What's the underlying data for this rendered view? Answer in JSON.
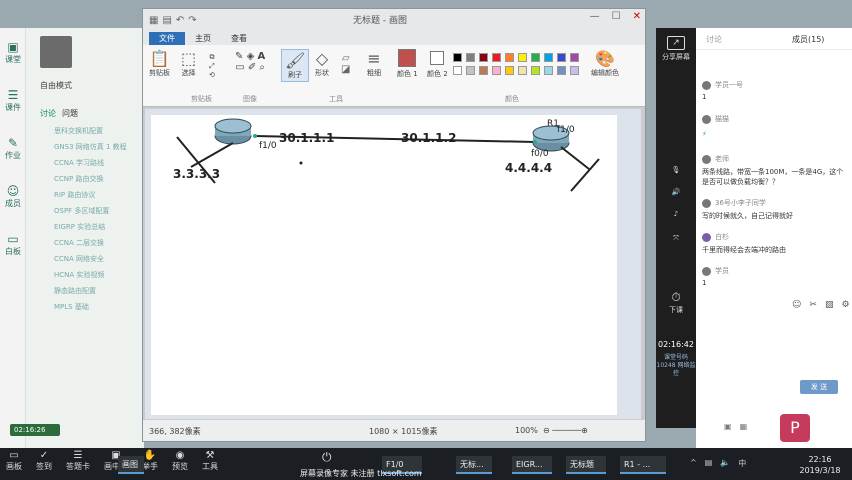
{
  "left_panel": {
    "rail": [
      {
        "icon": "classroom-icon",
        "label": "课堂"
      },
      {
        "icon": "courseware-icon",
        "label": "课件"
      },
      {
        "icon": "homework-icon",
        "label": "作业"
      },
      {
        "icon": "member-icon",
        "label": "成员"
      },
      {
        "icon": "screen-icon",
        "label": "白板"
      }
    ],
    "profile_name": "自由模式",
    "tabs": [
      "讨论",
      "问题"
    ],
    "messages": [
      "思科交换机配置",
      "GNS3 网络仿真 1 教程",
      "CCNA 学习路线",
      "CCNP 路由交换",
      "RIP 路由协议",
      "OSPF 多区域配置",
      "EIGRP 实验总结",
      "CCNA 二层交换",
      "CCNA 网络安全",
      "HCNA 实验视频",
      "静态路由配置",
      "MPLS 基础"
    ],
    "clock": "02:16:26"
  },
  "paint": {
    "title": "无标题 - 画图",
    "tabs": {
      "file": "文件",
      "home": "主页",
      "view": "查看"
    },
    "groups": {
      "clipboard": "剪贴板",
      "image": "图像",
      "tools": "工具",
      "shapes": "形状",
      "colors": "颜色"
    },
    "buttons": {
      "paste": "剪贴板",
      "select": "选择",
      "brush": "刷子",
      "shape": "形状",
      "size": "粗细",
      "color1": "颜色 1",
      "color2": "颜色 2",
      "edit_colors": "编辑颜色"
    },
    "status": {
      "cursor": "366, 382像素",
      "size": "1080 × 1015像素",
      "zoom": "100%"
    },
    "colors": {
      "row1": [
        "#000000",
        "#7f7f7f",
        "#880015",
        "#ed1c24",
        "#ff7f27",
        "#fff200",
        "#22b14c",
        "#00a2e8",
        "#3f48cc",
        "#a349a4"
      ],
      "row2": [
        "#ffffff",
        "#c3c3c3",
        "#b97a57",
        "#ffaec9",
        "#ffc90e",
        "#efe4b0",
        "#b5e61d",
        "#99d9ea",
        "#7092be",
        "#c8bfe7"
      ],
      "color1": "#c0504d"
    }
  },
  "diagram": {
    "left_router_iface": "f1/0",
    "right_router_name": "R1",
    "right_router_iface_top": "f1/0",
    "right_router_iface": "f0/0",
    "left_ip": "30.1.1.1",
    "right_ip": "30.1.1.2",
    "left_net": "3.3.3.3",
    "right_net": "4.4.4.4"
  },
  "chat": {
    "tabs": {
      "discussion": "讨论",
      "members": "成员(15)"
    },
    "entries": [
      {
        "user": "学员一号",
        "body": "1"
      },
      {
        "user": "猫猫",
        "body": ""
      },
      {
        "user": "",
        "body": ""
      },
      {
        "user": "老师",
        "body": "两条线路，带宽一条100M，一条是4G，这个是否可以做负载均衡？？"
      },
      {
        "user": "36号小李子同学",
        "body": "写的时候就久，自己记得就好"
      },
      {
        "user": "白杉",
        "body": "千里而得经会去端冲的路由"
      },
      {
        "user": "学员",
        "body": "1"
      }
    ],
    "send": "发 送"
  },
  "tool_strip": {
    "share": "分享屏幕",
    "end": "下课",
    "clock": "02:16:42",
    "room": "课堂号码 10248 网络监控"
  },
  "taskbar": {
    "menu": [
      "画板",
      "签到",
      "答题卡",
      "画中画",
      "举手",
      "预览",
      "工具"
    ],
    "apps": [
      "画图",
      "F1/0",
      "无标...",
      "EIGR...",
      "无标题",
      "R1 - ..."
    ],
    "watermark": "屏幕录像专家 未注册 tlxsoft.com",
    "time": "22:16",
    "date": "2019/3/18"
  }
}
